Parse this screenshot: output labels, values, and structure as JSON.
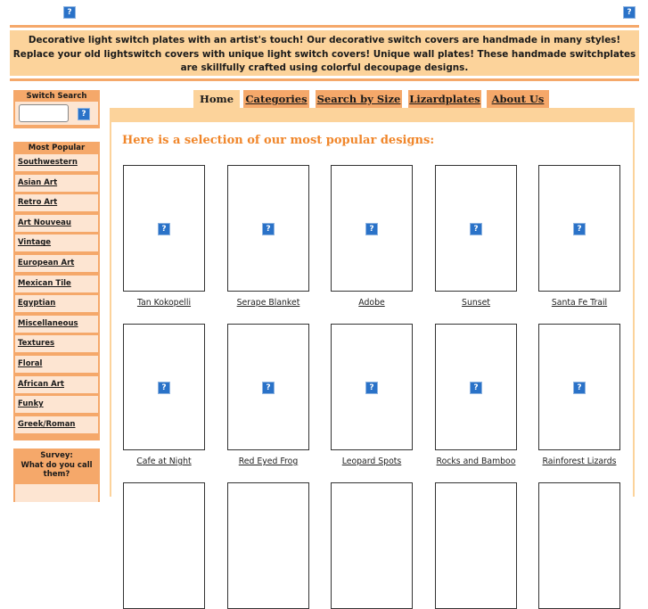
{
  "header": {
    "logo_left_icon": "broken-image-icon",
    "logo_right_icon": "broken-image-icon",
    "broken_image_glyph": "?",
    "tagline": "Decorative light switch plates with an artist's touch! Our decorative switch covers are handmade in many styles! Replace your old lightswitch covers with unique light switch covers! Unique wall plates! These handmade switchplates are skillfully crafted using colorful decoupage designs."
  },
  "sidebar": {
    "search": {
      "title": "Switch Search",
      "input_value": "",
      "go_icon": "broken-image-icon"
    },
    "popular": {
      "title": "Most Popular",
      "items": [
        {
          "label": "Southwestern"
        },
        {
          "label": "Asian Art"
        },
        {
          "label": "Retro Art"
        },
        {
          "label": "Art Nouveau"
        },
        {
          "label": "Vintage"
        },
        {
          "label": "European Art"
        },
        {
          "label": "Mexican Tile"
        },
        {
          "label": "Egyptian"
        },
        {
          "label": "Miscellaneous"
        },
        {
          "label": "Textures"
        },
        {
          "label": "Floral"
        },
        {
          "label": "African Art"
        },
        {
          "label": "Funky"
        },
        {
          "label": "Greek/Roman"
        }
      ]
    },
    "survey": {
      "title_line1": "Survey:",
      "title_line2": "What do you call",
      "title_line3": "them?"
    }
  },
  "nav": {
    "tabs": [
      {
        "label": "Home",
        "active": true
      },
      {
        "label": "Categories",
        "active": false
      },
      {
        "label": "Search by Size",
        "active": false
      },
      {
        "label": "Lizardplates",
        "active": false
      },
      {
        "label": "About Us",
        "active": false
      }
    ]
  },
  "main": {
    "heading": "Here is a selection of our most popular designs:",
    "products": [
      {
        "name": "Tan Kokopelli"
      },
      {
        "name": "Serape Blanket"
      },
      {
        "name": "Adobe"
      },
      {
        "name": "Sunset"
      },
      {
        "name": "Santa Fe Trail"
      },
      {
        "name": "Cafe at Night"
      },
      {
        "name": "Red Eyed Frog"
      },
      {
        "name": "Leopard Spots"
      },
      {
        "name": "Rocks and Bamboo"
      },
      {
        "name": "Rainforest Lizards"
      }
    ]
  },
  "colors": {
    "accent_orange": "#f5a86a",
    "light_peach": "#fcd39b",
    "pale_peach": "#fde5d2",
    "heading_orange": "#f0862a",
    "broken_image_blue": "#2a72c8"
  }
}
